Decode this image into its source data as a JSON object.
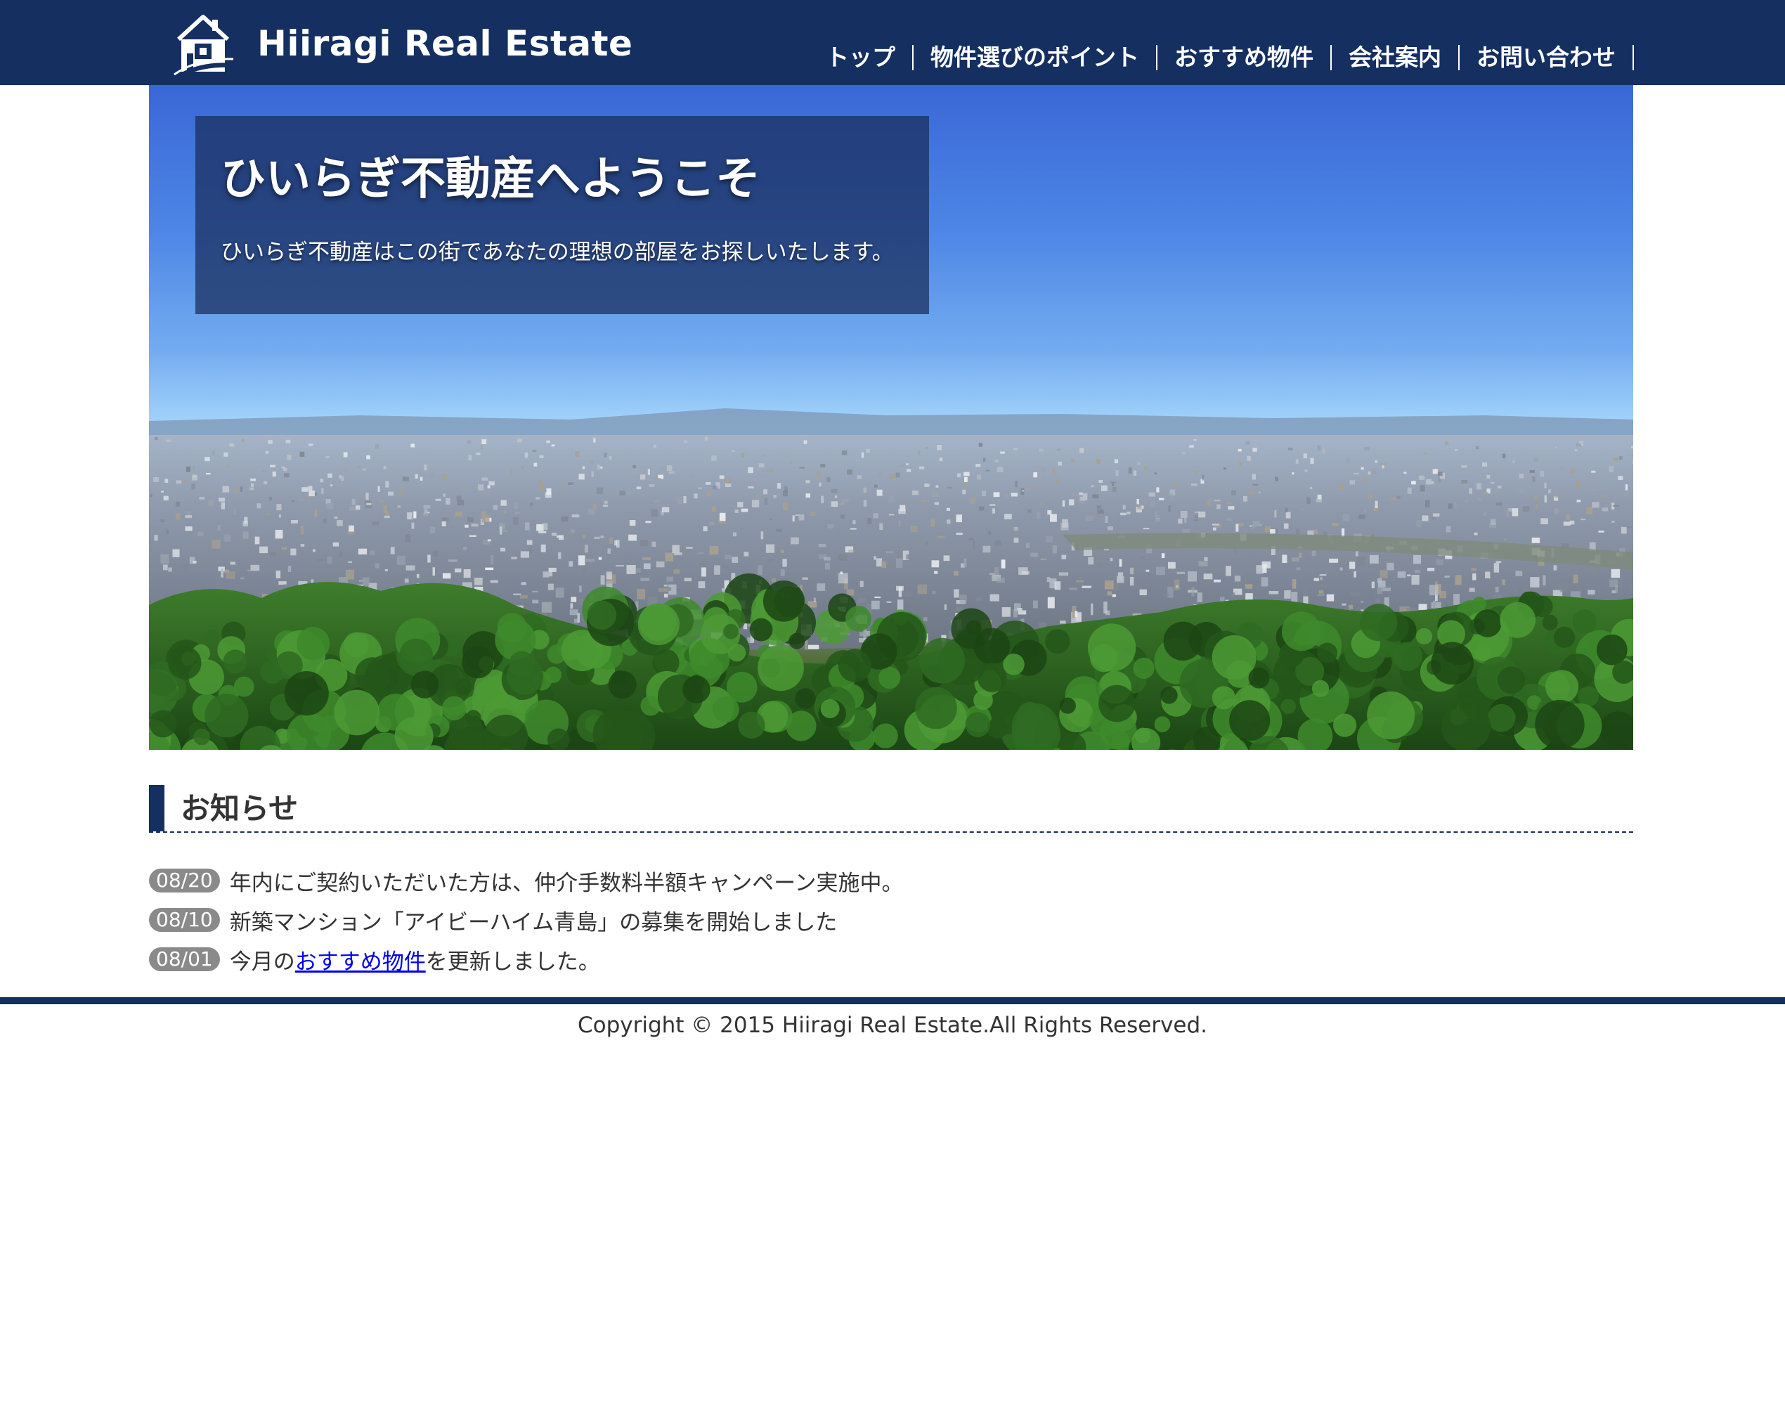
{
  "header": {
    "logo_text": "Hiiragi Real Estate",
    "logo_icon": "house-logo-icon",
    "nav": [
      {
        "label": "トップ"
      },
      {
        "label": "物件選びのポイント"
      },
      {
        "label": "おすすめ物件"
      },
      {
        "label": "会社案内"
      },
      {
        "label": "お問い合わせ"
      }
    ]
  },
  "hero": {
    "title": "ひいらぎ不動産へようこそ",
    "subtitle": "ひいらぎ不動産はこの街であなたの理想の部屋をお探しいたします。"
  },
  "news": {
    "heading": "お知らせ",
    "items": [
      {
        "date": "08/20",
        "text": "年内にご契約いただいた方は、仲介手数料半額キャンペーン実施中。"
      },
      {
        "date": "08/10",
        "text": "新築マンション「アイビーハイム青島」の募集を開始しました"
      },
      {
        "date": "08/01",
        "text_before": "今月の",
        "link": "おすすめ物件",
        "text_after": "を更新しました。"
      }
    ]
  },
  "footer": {
    "copyright": "Copyright © 2015 Hiiragi Real Estate.All Rights Reserved."
  },
  "colors": {
    "brand_navy": "#142f60",
    "date_badge": "#8a8a8a",
    "link": "#0000ee"
  }
}
